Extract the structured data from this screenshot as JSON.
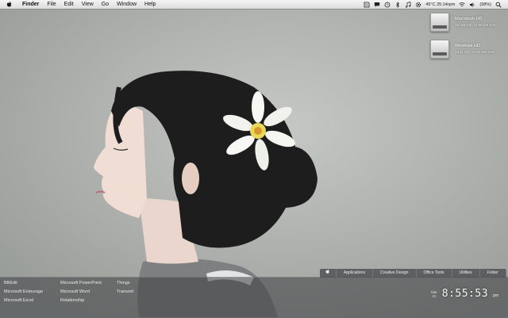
{
  "menubar": {
    "apple_icon": "apple-logo-icon",
    "items": [
      "Finder",
      "File",
      "Edit",
      "View",
      "Go",
      "Window",
      "Help"
    ],
    "status": {
      "temperature_time": "45°C 25:14rpm",
      "battery": "(98%)"
    }
  },
  "desktop": {
    "drives": [
      {
        "name": "Macintosh HD",
        "info": "111.68 GB, 16.96 GB free"
      },
      {
        "name": "Windows HD",
        "info": "32.11 GB, 24.64 GB free"
      }
    ]
  },
  "shelf": {
    "columns": [
      [
        "BBEdit",
        "Microsoft Entourage",
        "Microsoft Excel"
      ],
      [
        "Microsoft PowerPoint",
        "Microsoft Word",
        "Relationship"
      ],
      [
        "Things",
        "Transmit"
      ]
    ],
    "tabs": [
      "Applications",
      "Creative Design",
      "Office Tools",
      "Utilities",
      "Folder"
    ],
    "clock": {
      "day": "Mar",
      "date": "31",
      "time": "8:55:53",
      "period": "pm"
    }
  }
}
